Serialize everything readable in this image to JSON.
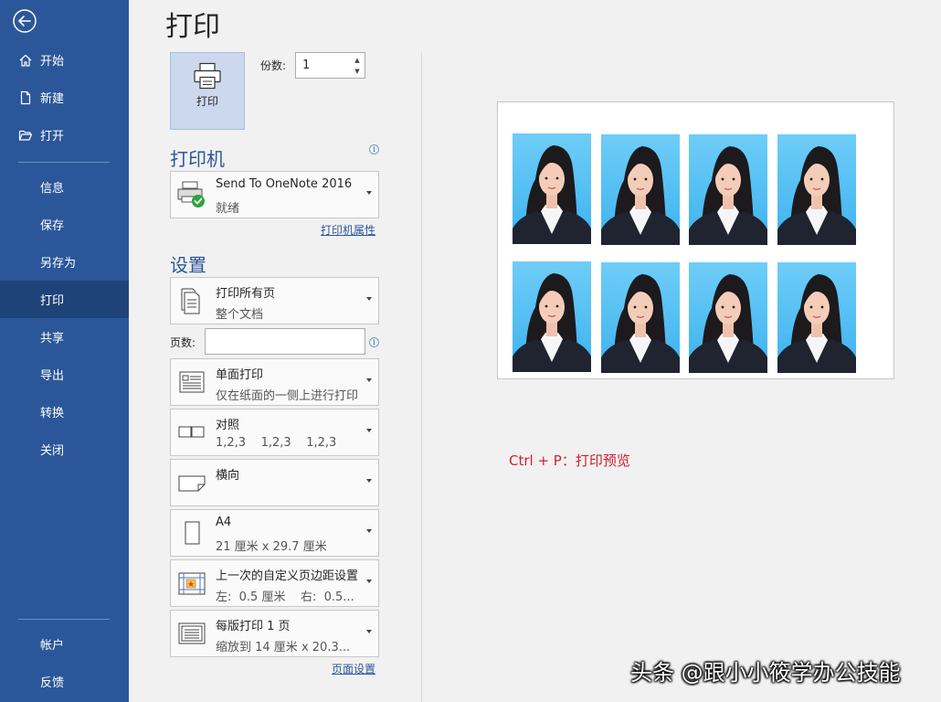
{
  "sidebar": {
    "items": [
      {
        "label": "开始",
        "icon": "home-icon"
      },
      {
        "label": "新建",
        "icon": "new-doc-icon"
      },
      {
        "label": "打开",
        "icon": "open-folder-icon"
      },
      {
        "label": "信息"
      },
      {
        "label": "保存"
      },
      {
        "label": "另存为"
      },
      {
        "label": "打印",
        "active": true
      },
      {
        "label": "共享"
      },
      {
        "label": "导出"
      },
      {
        "label": "转换"
      },
      {
        "label": "关闭"
      }
    ],
    "bottom_items": [
      {
        "label": "帐户"
      },
      {
        "label": "反馈"
      }
    ]
  },
  "page_title": "打印",
  "print_button_label": "打印",
  "copies": {
    "label": "份数:",
    "value": "1"
  },
  "printer": {
    "header": "打印机",
    "name": "Send To OneNote 2016",
    "status": "就绪",
    "properties_link": "打印机属性"
  },
  "settings": {
    "header": "设置",
    "print_range": {
      "title": "打印所有页",
      "sub": "整个文档"
    },
    "pages_label": "页数:",
    "pages_value": "",
    "sides": {
      "title": "单面打印",
      "sub": "仅在纸面的一侧上进行打印"
    },
    "collate": {
      "title": "对照",
      "sub": "1,2,3    1,2,3    1,2,3"
    },
    "orientation": {
      "title": "横向",
      "sub": ""
    },
    "paper": {
      "title": "A4",
      "sub": "21 厘米 x 29.7 厘米"
    },
    "margins": {
      "title": "上一次的自定义页边距设置",
      "sub": "左:  0.5 厘米    右:  0.5..."
    },
    "pages_per_sheet": {
      "title": "每版打印 1 页",
      "sub": "缩放到 14 厘米 x 20.3..."
    },
    "page_setup_link": "页面设置"
  },
  "preview": {
    "photo_count": 8
  },
  "annotation": "Ctrl + P：打印预览",
  "watermark": "头条 @跟小小筱学办公技能",
  "colors": {
    "sidebar_bg": "#2b579a",
    "sidebar_active": "#1e4379",
    "accent": "#2b579a",
    "annotation": "#d0202a",
    "photo_bg": "#49bbf2"
  }
}
